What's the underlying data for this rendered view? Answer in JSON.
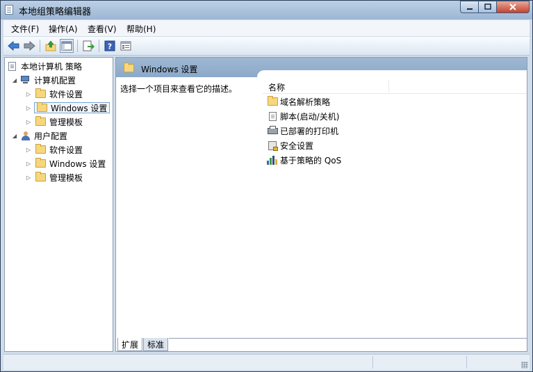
{
  "window": {
    "title": "本地组策略编辑器"
  },
  "menubar": {
    "items": [
      "文件(F)",
      "操作(A)",
      "查看(V)",
      "帮助(H)"
    ]
  },
  "toolbar": {
    "icons": [
      "back-arrow-icon",
      "forward-arrow-icon",
      "up-folder-icon",
      "show-hide-tree-icon",
      "export-list-icon",
      "help-icon",
      "properties-icon"
    ]
  },
  "tree": {
    "root": "本地计算机 策略",
    "computer_config": "计算机配置",
    "user_config": "用户配置",
    "computer_children": [
      "软件设置",
      "Windows 设置",
      "管理模板"
    ],
    "user_children": [
      "软件设置",
      "Windows 设置",
      "管理模板"
    ],
    "selected": "Windows 设置"
  },
  "details": {
    "header_title": "Windows 设置",
    "description": "选择一个项目来查看它的描述。",
    "column_name": "名称",
    "items": [
      "域名解析策略",
      "脚本(启动/关机)",
      "已部署的打印机",
      "安全设置",
      "基于策略的 QoS"
    ]
  },
  "tabs": {
    "extended": "扩展",
    "standard": "标准"
  },
  "colors": {
    "header_blue": "#9fb8d3",
    "folder_yellow": "#f7d77e",
    "close_red": "#c4432e"
  }
}
